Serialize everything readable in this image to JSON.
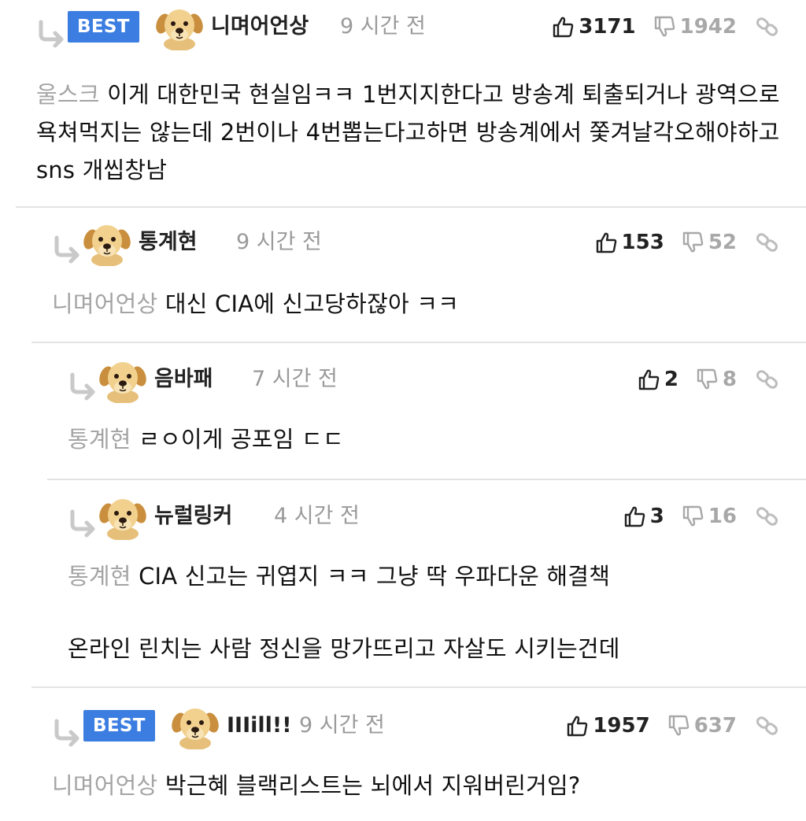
{
  "icons": {
    "reply": "reply-arrow-icon",
    "up": "thumbs-up-icon",
    "down": "thumbs-down-icon",
    "link": "link-icon",
    "avatar": "puppy-avatar"
  },
  "comments": [
    {
      "best": "BEST",
      "author": "니며어언상",
      "time": "9 시간 전",
      "up": "3171",
      "down": "1942",
      "mention": "울스크",
      "text": "이게 대한민국 현실임ㅋㅋ 1번지지한다고 방송계 퇴출되거나 광역으로 욕쳐먹지는 않는데 2번이나 4번뽑는다고하면 방송계에서 쫓겨날각오해야하고 sns 개씹창남",
      "text2": ""
    },
    {
      "best": "",
      "author": "통계현",
      "time": "9 시간 전",
      "up": "153",
      "down": "52",
      "mention": "니며어언상",
      "text": "대신 CIA에 신고당하잖아 ㅋㅋ",
      "text2": ""
    },
    {
      "best": "",
      "author": "음바패",
      "time": "7 시간 전",
      "up": "2",
      "down": "8",
      "mention": "통계현",
      "text": "ㄹㅇ이게 공포임 ㄷㄷ",
      "text2": ""
    },
    {
      "best": "",
      "author": "뉴럴링커",
      "time": "4 시간 전",
      "up": "3",
      "down": "16",
      "mention": "통계현",
      "text": "CIA 신고는 귀엽지 ㅋㅋ 그냥 딱 우파다운 해결책",
      "text2": "온라인 린치는 사람 정신을 망가뜨리고 자살도 시키는건데"
    },
    {
      "best": "BEST",
      "author": "IIIill!!",
      "time": "9 시간 전",
      "up": "1957",
      "down": "637",
      "mention": "니며어언상",
      "text": "박근혜 블랙리스트는 뇌에서 지워버린거임?",
      "text2": ""
    }
  ]
}
